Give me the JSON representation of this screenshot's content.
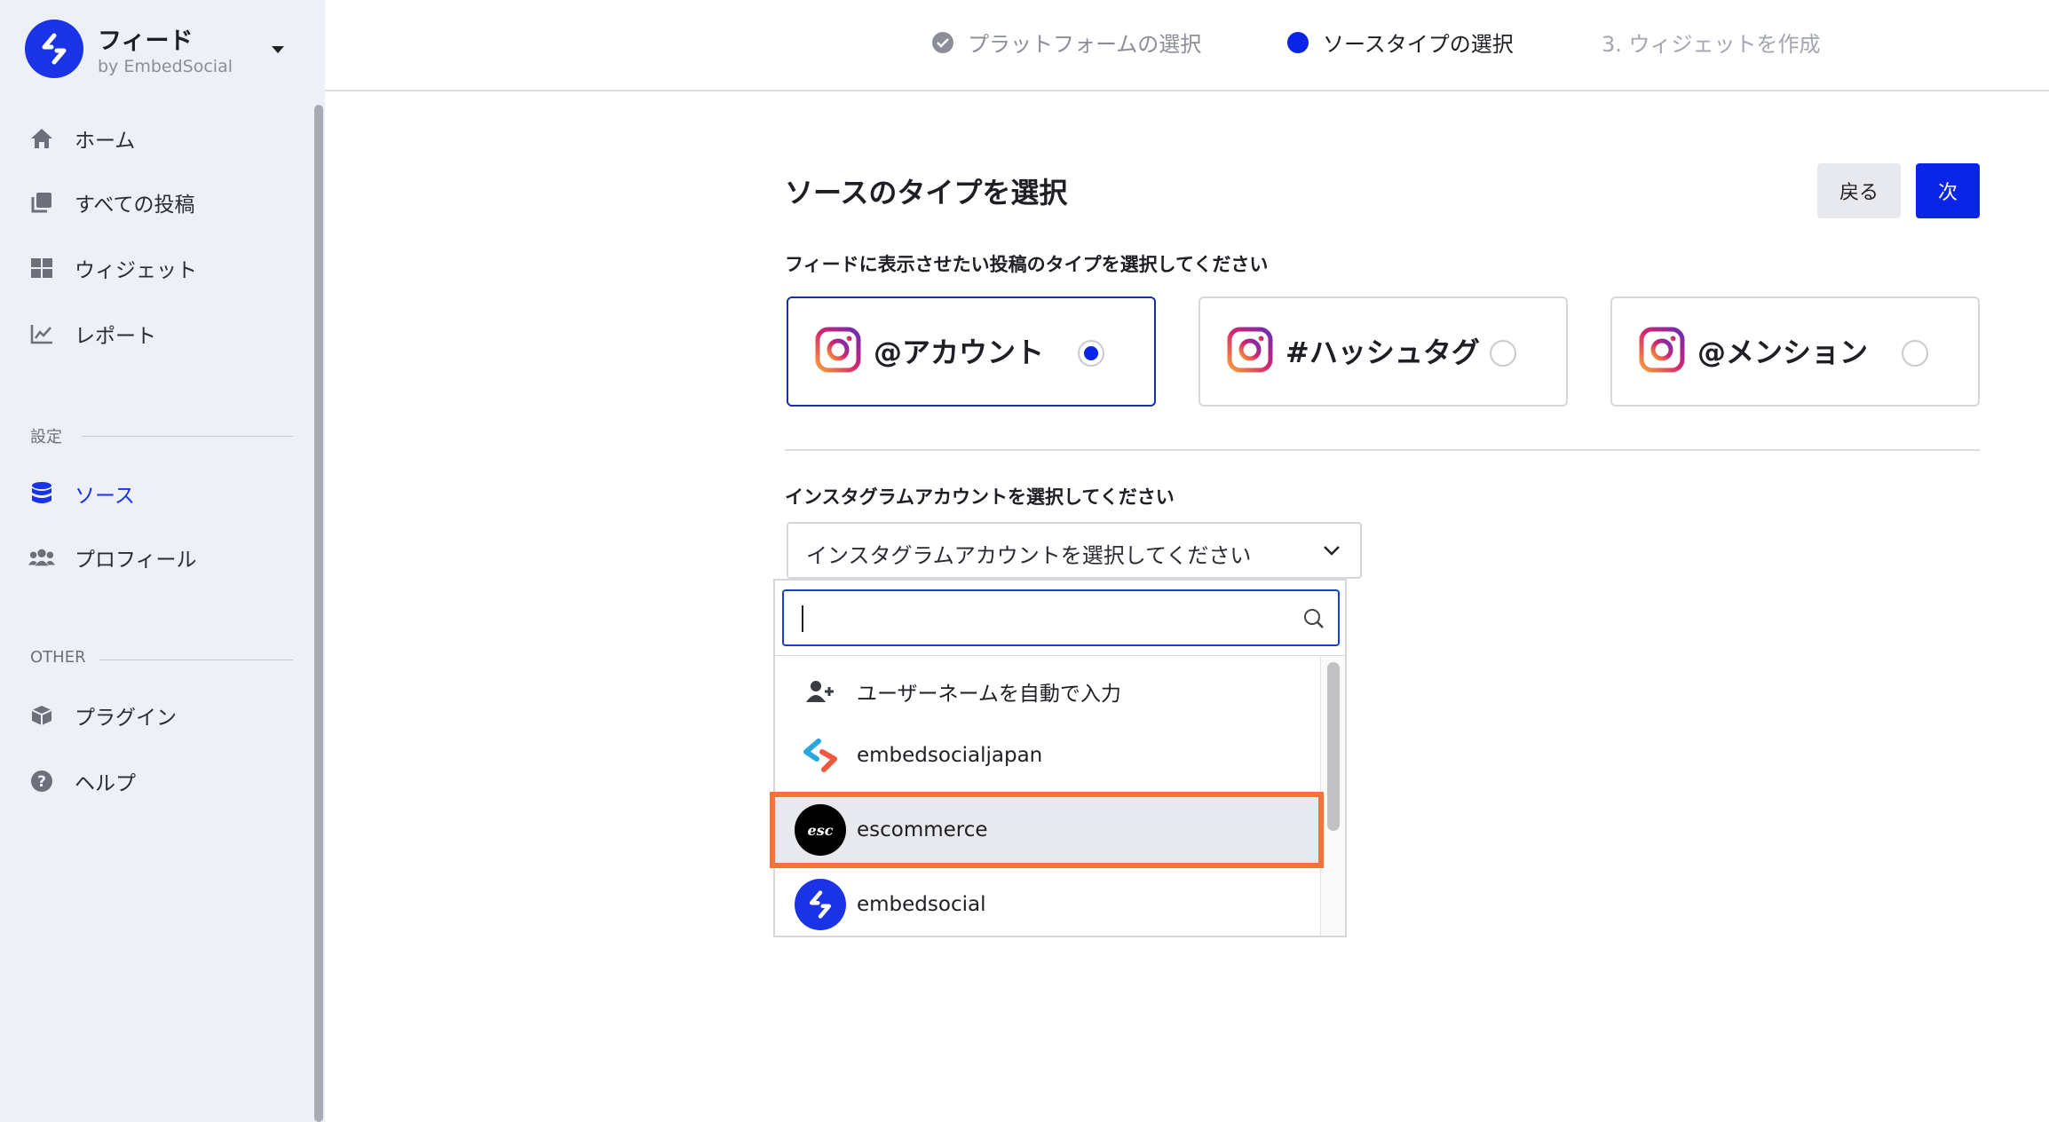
{
  "brand": {
    "title": "フィード",
    "subtitle": "by EmbedSocial"
  },
  "sidebar": {
    "items": [
      {
        "label": "ホーム",
        "icon": "home-icon"
      },
      {
        "label": "すべての投稿",
        "icon": "posts-icon"
      },
      {
        "label": "ウィジェット",
        "icon": "widgets-icon"
      },
      {
        "label": "レポート",
        "icon": "chart-icon"
      }
    ],
    "settings_heading": "設定",
    "settings_items": [
      {
        "label": "ソース",
        "icon": "database-icon",
        "active": true
      },
      {
        "label": "プロフィール",
        "icon": "users-icon"
      }
    ],
    "other_heading": "OTHER",
    "other_items": [
      {
        "label": "プラグイン",
        "icon": "box-icon"
      },
      {
        "label": "ヘルプ",
        "icon": "help-icon"
      }
    ]
  },
  "steps": [
    {
      "label": "プラットフォームの選択",
      "state": "done"
    },
    {
      "label": "ソースタイプの選択",
      "state": "current"
    },
    {
      "label": "3. ウィジェットを作成",
      "state": "pending"
    }
  ],
  "main": {
    "title": "ソースのタイプを選択",
    "back_label": "戻る",
    "next_label": "次",
    "type_prompt": "フィードに表示させたい投稿のタイプを選択してください",
    "types": [
      {
        "label": "@アカウント",
        "selected": true
      },
      {
        "label": "#ハッシュタグ",
        "selected": false
      },
      {
        "label": "@メンション",
        "selected": false
      }
    ],
    "account_prompt": "インスタグラムアカウントを選択してください",
    "select_placeholder": "インスタグラムアカウントを選択してください",
    "search_value": "",
    "options": [
      {
        "label": "ユーザーネームを自動で入力",
        "icon": "add-user-icon"
      },
      {
        "label": "embedsocialjapan",
        "icon": "embedsocial-logo-icon"
      },
      {
        "label": "escommerce",
        "icon": "esc-avatar-icon",
        "avatar_text": "esc",
        "highlighted": true
      },
      {
        "label": "embedsocial",
        "icon": "embedsocial-circle-icon"
      }
    ]
  },
  "colors": {
    "accent": "#0a24e8",
    "highlight_border": "#f3733a",
    "sidebar_bg": "#eef0f7"
  }
}
